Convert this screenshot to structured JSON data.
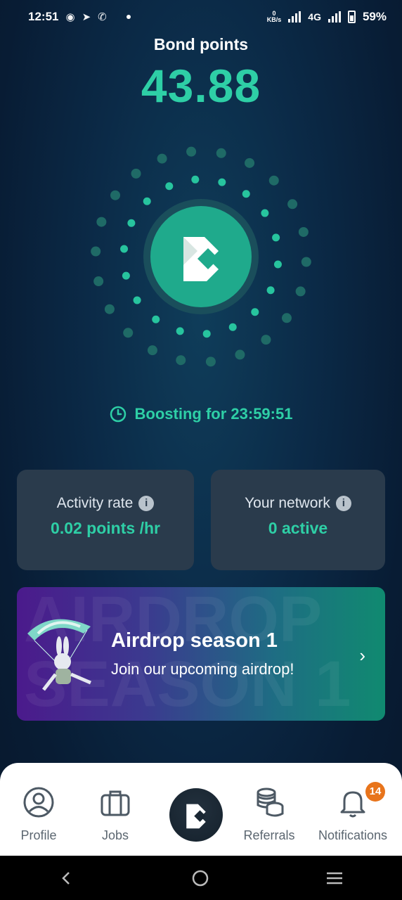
{
  "status": {
    "time": "12:51",
    "net_speed_top": "0",
    "net_speed_unit": "KB/s",
    "network": "4G",
    "battery": "59%"
  },
  "header": {
    "title": "Bond points",
    "points": "43.88"
  },
  "boost": {
    "text": "Boosting for 23:59:51"
  },
  "cards": {
    "activity": {
      "label": "Activity rate",
      "value": "0.02 points /hr"
    },
    "network": {
      "label": "Your network",
      "value": "0 active"
    }
  },
  "airdrop": {
    "bg_text": "AIRDROP\nSEASON 1",
    "title": "Airdrop season 1",
    "subtitle": "Join our upcoming airdrop!"
  },
  "nav": {
    "profile": "Profile",
    "jobs": "Jobs",
    "referrals": "Referrals",
    "notifications": "Notifications",
    "badge": "14"
  },
  "colors": {
    "accent": "#2ecfa6",
    "badge": "#e8741b"
  }
}
